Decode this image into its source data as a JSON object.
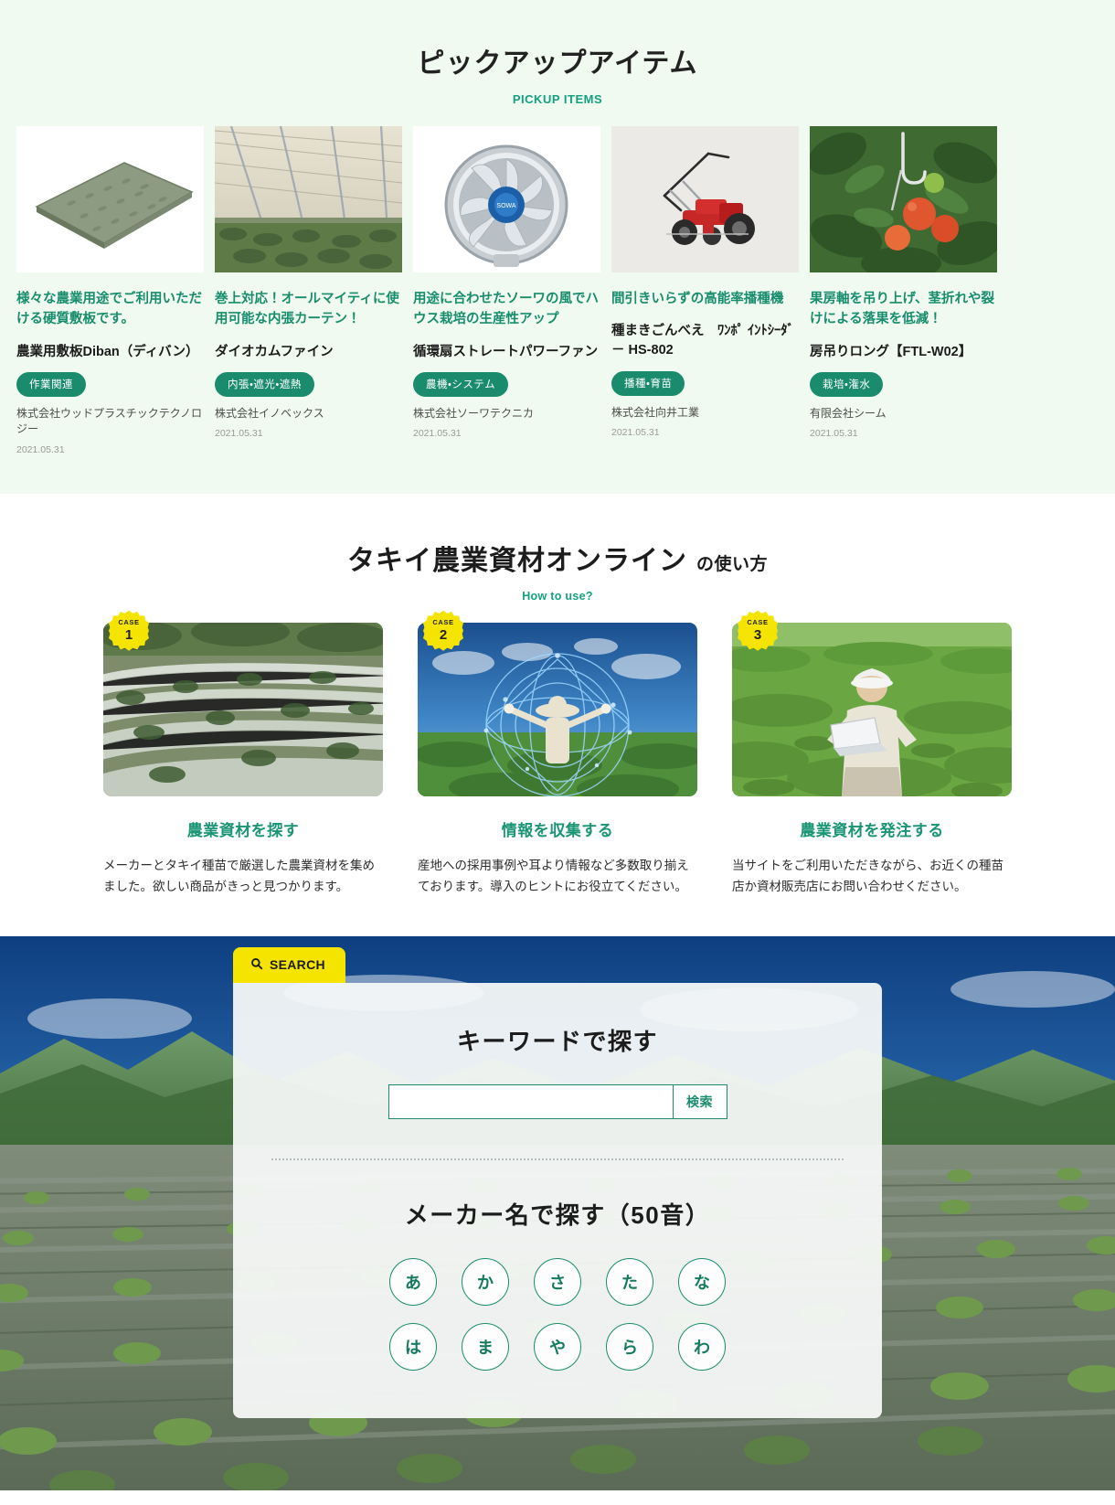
{
  "pickup": {
    "title": "ピックアップアイテム",
    "subtitle": "PICKUP ITEMS",
    "items": [
      {
        "lead": "様々な農業用途でご利用いただける硬質敷板です。",
        "name": "農業用敷板Diban（ディバン）",
        "tag": "作業関連",
        "maker": "株式会社ウッドプラスチックテクノロジー",
        "date": "2021.05.31",
        "image": "green-checker-plate-board"
      },
      {
        "lead": "巻上対応！オールマイティに使用可能な内張カーテン！",
        "name": "ダイオカムファイン",
        "tag": "内張・遮光・遮熱",
        "maker": "株式会社イノベックス",
        "date": "2021.05.31",
        "image": "greenhouse-interior-curtain"
      },
      {
        "lead": "用途に合わせたソーワの風でハウス栽培の生産性アップ",
        "name": "循環扇ストレートパワーファン",
        "tag": "農機・システム",
        "maker": "株式会社ソーワテクニカ",
        "date": "2021.05.31",
        "image": "circulation-fan"
      },
      {
        "lead": "間引きいらずの高能率播種機",
        "name": "種まきごんべえ　ﾜﾝﾎﾟ ｲﾝﾄｼｰﾀﾞ － HS-802",
        "tag": "播種・育苗",
        "maker": "株式会社向井工業",
        "date": "2021.05.31",
        "image": "red-seeder-machine"
      },
      {
        "lead": "果房軸を吊り上げ、茎折れや裂けによる落果を低減！",
        "name": "房吊りロング【FTL-W02】",
        "tag": "栽培・潅水",
        "maker": "有限会社シーム",
        "date": "2021.05.31",
        "image": "tomato-truss-support-hook"
      }
    ]
  },
  "howto": {
    "title_main": "タキイ農業資材オンライン",
    "title_sub": "の使い方",
    "subtitle": "How to use?",
    "cases": [
      {
        "badge_word": "CASE",
        "badge_num": "1",
        "heading": "農業資材を探す",
        "body": "メーカーとタキイ種苗で厳選した農業資材を集めました。欲しい商品がきっと見つかります。",
        "image": "plastic-tunnel-field-rows"
      },
      {
        "badge_word": "CASE",
        "badge_num": "2",
        "heading": "情報を収集する",
        "body": "産地への採用事例や耳より情報など多数取り揃えております。導入のヒントにお役立てください。",
        "image": "farmer-with-hat-digital-network"
      },
      {
        "badge_word": "CASE",
        "badge_num": "3",
        "heading": "農業資材を発注する",
        "body": "当サイトをご利用いただきながら、お近くの種苗店か資材販売店にお問い合わせください。",
        "image": "farmer-with-laptop-in-field"
      }
    ]
  },
  "search": {
    "tab_label": "SEARCH",
    "tab_icon": "search-icon",
    "keyword_title": "キーワードで探す",
    "keyword_value": "",
    "keyword_placeholder": "",
    "search_button": "検索",
    "maker_title": "メーカー名で探す（50音）",
    "kana_rows": [
      [
        "あ",
        "か",
        "さ",
        "た",
        "な"
      ],
      [
        "は",
        "ま",
        "や",
        "ら",
        "わ"
      ]
    ],
    "background": "lettuce-field-with-mulch-and-mountains"
  },
  "colors": {
    "brand_green": "#1a8c6d",
    "accent_yellow": "#f5e400",
    "pickup_bg": "#f1faf0",
    "hero_sky": "#1f4e8c"
  }
}
